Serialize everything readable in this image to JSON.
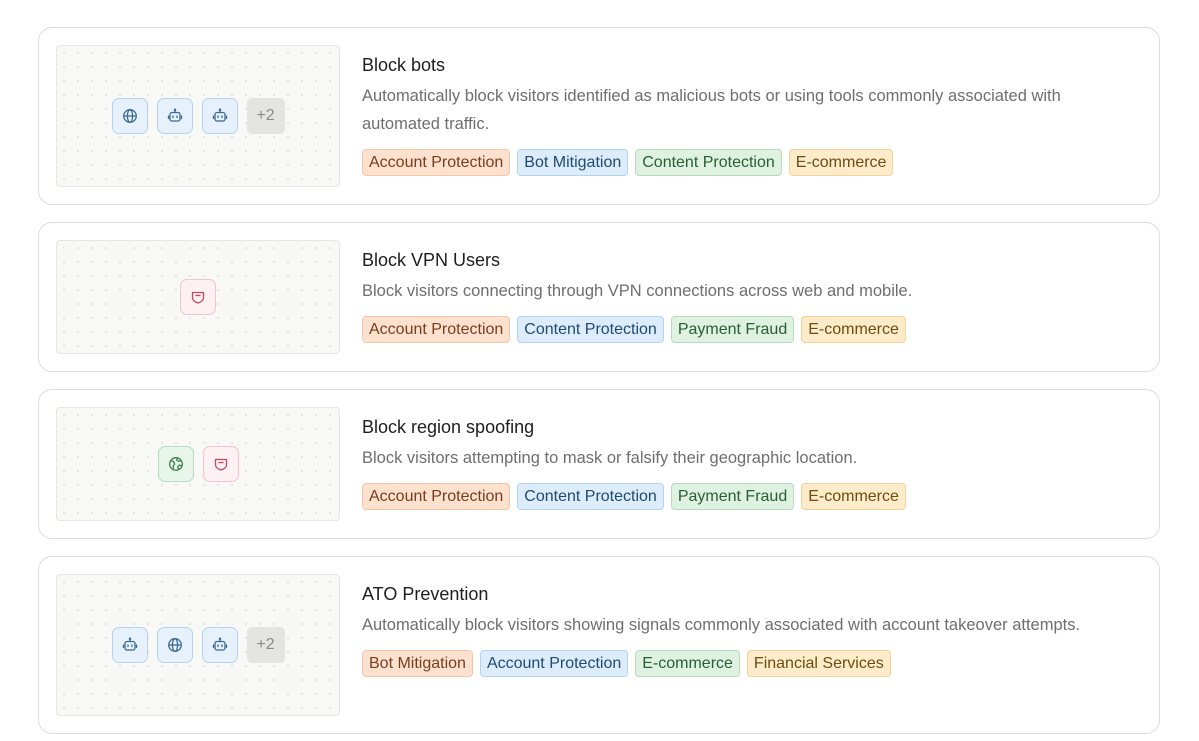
{
  "rules": [
    {
      "title": "Block bots",
      "description": "Automatically block visitors identified as malicious bots or using tools commonly associated with automated traffic.",
      "icons": [
        {
          "name": "globe-icon",
          "color": "blue"
        },
        {
          "name": "bot-icon",
          "color": "blue"
        },
        {
          "name": "bot-icon",
          "color": "blue"
        }
      ],
      "more": "+2",
      "tags": [
        {
          "label": "Account Protection",
          "color": "orange"
        },
        {
          "label": "Bot Mitigation",
          "color": "blue"
        },
        {
          "label": "Content Protection",
          "color": "green"
        },
        {
          "label": "E-commerce",
          "color": "yellow"
        }
      ]
    },
    {
      "title": "Block VPN Users",
      "description": "Block visitors connecting through VPN connections across web and mobile.",
      "icons": [
        {
          "name": "vpn-shield-icon",
          "color": "pink"
        }
      ],
      "more": "",
      "tags": [
        {
          "label": "Account Protection",
          "color": "orange"
        },
        {
          "label": "Content Protection",
          "color": "blue"
        },
        {
          "label": "Payment Fraud",
          "color": "green"
        },
        {
          "label": "E-commerce",
          "color": "yellow"
        }
      ]
    },
    {
      "title": "Block region spoofing",
      "description": "Block visitors attempting to mask or falsify their geographic location.",
      "icons": [
        {
          "name": "earth-icon",
          "color": "green"
        },
        {
          "name": "vpn-shield-icon",
          "color": "pink"
        }
      ],
      "more": "",
      "tags": [
        {
          "label": "Account Protection",
          "color": "orange"
        },
        {
          "label": "Content Protection",
          "color": "blue"
        },
        {
          "label": "Payment Fraud",
          "color": "green"
        },
        {
          "label": "E-commerce",
          "color": "yellow"
        }
      ]
    },
    {
      "title": "ATO Prevention",
      "description": "Automatically block visitors showing signals commonly associated with account takeover attempts.",
      "icons": [
        {
          "name": "bot-icon",
          "color": "blue"
        },
        {
          "name": "globe-icon",
          "color": "blue"
        },
        {
          "name": "bot-icon",
          "color": "blue"
        }
      ],
      "more": "+2",
      "tags": [
        {
          "label": "Bot Mitigation",
          "color": "orange"
        },
        {
          "label": "Account Protection",
          "color": "blue"
        },
        {
          "label": "E-commerce",
          "color": "green"
        },
        {
          "label": "Financial Services",
          "color": "yellow"
        }
      ]
    }
  ]
}
